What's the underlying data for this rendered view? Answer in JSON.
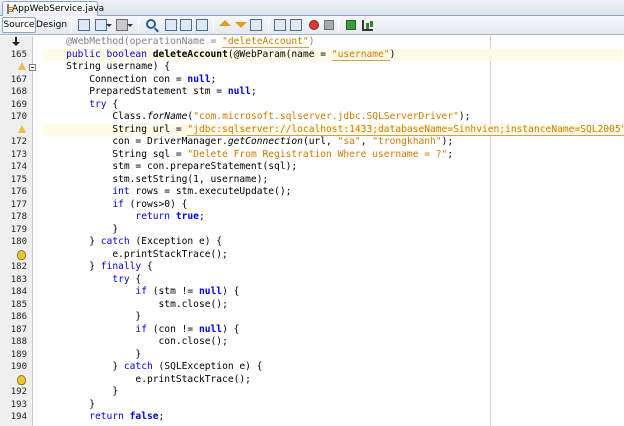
{
  "file_tab": {
    "title": "AppWebService.java",
    "icon": "java-file-icon"
  },
  "toolbar": {
    "source_tab": "Source",
    "design_tab": "Design"
  },
  "editor": {
    "lines": [
      {
        "no": "",
        "tokens": [
          [
            "ann",
            "@WebMethod(operationName = "
          ],
          [
            "str-ul",
            "\"deleteAccount\""
          ],
          [
            "ann",
            ")"
          ]
        ],
        "indent": 4,
        "gutter": "arrow"
      },
      {
        "no": "165",
        "tokens": [
          [
            "kw",
            "public "
          ],
          [
            "kw",
            "boolean "
          ],
          [
            "mth",
            "deleteAccount"
          ],
          [
            "",
            "(@WebParam(name = "
          ],
          [
            "str-ul",
            "\"username\""
          ],
          [
            "",
            ")"
          ]
        ],
        "indent": 4,
        "hl": true
      },
      {
        "no": "",
        "tokens": [
          [
            "",
            "String username) {"
          ]
        ],
        "indent": 4,
        "gutter": "hint",
        "fold": true
      },
      {
        "no": "167",
        "tokens": [
          [
            "",
            "Connection con = "
          ],
          [
            "kwb",
            "null"
          ],
          [
            "",
            ";"
          ]
        ],
        "indent": 8
      },
      {
        "no": "168",
        "tokens": [
          [
            "",
            "PreparedStatement stm = "
          ],
          [
            "kwb",
            "null"
          ],
          [
            "",
            ";"
          ]
        ],
        "indent": 8
      },
      {
        "no": "169",
        "tokens": [
          [
            "kw",
            "try "
          ],
          [
            "",
            "{"
          ]
        ],
        "indent": 8
      },
      {
        "no": "170",
        "tokens": [
          [
            "",
            "Class."
          ],
          [
            "ital",
            "forName"
          ],
          [
            "",
            "("
          ],
          [
            "str",
            "\"com.microsoft.sqlserver.jdbc.SQLServerDriver\""
          ],
          [
            "",
            ");"
          ]
        ],
        "indent": 12
      },
      {
        "no": "",
        "tokens": [
          [
            "",
            "String url = "
          ],
          [
            "str-ul",
            "\"jdbc:sqlserver://localhost:1433;databaseName=Sinhvien;instanceName=SQL2005\""
          ],
          [
            "",
            ";"
          ]
        ],
        "indent": 12,
        "gutter": "hint",
        "hl": true
      },
      {
        "no": "172",
        "tokens": [
          [
            "",
            "con = DriverManager."
          ],
          [
            "ital",
            "getConnection"
          ],
          [
            "",
            "(url, "
          ],
          [
            "str",
            "\"sa\""
          ],
          [
            "",
            ", "
          ],
          [
            "str",
            "\"trongkhanh\""
          ],
          [
            "",
            ");"
          ]
        ],
        "indent": 12
      },
      {
        "no": "173",
        "tokens": [
          [
            "",
            "String sql = "
          ],
          [
            "str",
            "\"Delete From Registration Where username = ?\""
          ],
          [
            "",
            ";"
          ]
        ],
        "indent": 12
      },
      {
        "no": "174",
        "tokens": [
          [
            "",
            "stm = con.prepareStatement(sql);"
          ]
        ],
        "indent": 12
      },
      {
        "no": "175",
        "tokens": [
          [
            "",
            "stm.setString(1, username);"
          ]
        ],
        "indent": 12
      },
      {
        "no": "176",
        "tokens": [
          [
            "kw",
            "int "
          ],
          [
            "",
            "rows = stm.executeUpdate();"
          ]
        ],
        "indent": 12
      },
      {
        "no": "177",
        "tokens": [
          [
            "kw",
            "if "
          ],
          [
            "",
            "(rows>0) {"
          ]
        ],
        "indent": 12
      },
      {
        "no": "178",
        "tokens": [
          [
            "kw",
            "return "
          ],
          [
            "kwb",
            "true"
          ],
          [
            "",
            ";"
          ]
        ],
        "indent": 16
      },
      {
        "no": "179",
        "tokens": [
          [
            "",
            "}"
          ]
        ],
        "indent": 12
      },
      {
        "no": "180",
        "tokens": [
          [
            "",
            "} "
          ],
          [
            "kw",
            "catch "
          ],
          [
            "",
            "(Exception e) {"
          ]
        ],
        "indent": 8
      },
      {
        "no": "",
        "tokens": [
          [
            "",
            "e.printStackTrace();"
          ]
        ],
        "indent": 12,
        "gutter": "bulb"
      },
      {
        "no": "182",
        "tokens": [
          [
            "",
            "} "
          ],
          [
            "kw",
            "finally "
          ],
          [
            "",
            "{"
          ]
        ],
        "indent": 8
      },
      {
        "no": "183",
        "tokens": [
          [
            "kw",
            "try "
          ],
          [
            "",
            "{"
          ]
        ],
        "indent": 12
      },
      {
        "no": "184",
        "tokens": [
          [
            "kw",
            "if "
          ],
          [
            "",
            "(stm != "
          ],
          [
            "kwb",
            "null"
          ],
          [
            "",
            ") {"
          ]
        ],
        "indent": 16
      },
      {
        "no": "185",
        "tokens": [
          [
            "",
            "stm.close();"
          ]
        ],
        "indent": 20
      },
      {
        "no": "186",
        "tokens": [
          [
            "",
            "}"
          ]
        ],
        "indent": 16
      },
      {
        "no": "187",
        "tokens": [
          [
            "kw",
            "if "
          ],
          [
            "",
            "(con != "
          ],
          [
            "kwb",
            "null"
          ],
          [
            "",
            ") {"
          ]
        ],
        "indent": 16
      },
      {
        "no": "188",
        "tokens": [
          [
            "",
            "con.close();"
          ]
        ],
        "indent": 20
      },
      {
        "no": "189",
        "tokens": [
          [
            "",
            "}"
          ]
        ],
        "indent": 16
      },
      {
        "no": "190",
        "tokens": [
          [
            "",
            "} "
          ],
          [
            "kw",
            "catch "
          ],
          [
            "",
            "(SQLException e) {"
          ]
        ],
        "indent": 12
      },
      {
        "no": "",
        "tokens": [
          [
            "",
            "e.printStackTrace();"
          ]
        ],
        "indent": 16,
        "gutter": "bulb"
      },
      {
        "no": "192",
        "tokens": [
          [
            "",
            "}"
          ]
        ],
        "indent": 12
      },
      {
        "no": "193",
        "tokens": [
          [
            "",
            "}"
          ]
        ],
        "indent": 8
      },
      {
        "no": "194",
        "tokens": [
          [
            "kw",
            "return "
          ],
          [
            "kwb",
            "false"
          ],
          [
            "",
            ";"
          ]
        ],
        "indent": 8
      }
    ]
  },
  "colors": {
    "keyword": "#0000e6",
    "string": "#ce7b00",
    "annotation": "#808080",
    "current_line": "#fdfbe6",
    "right_margin": "#f2c8c8"
  }
}
